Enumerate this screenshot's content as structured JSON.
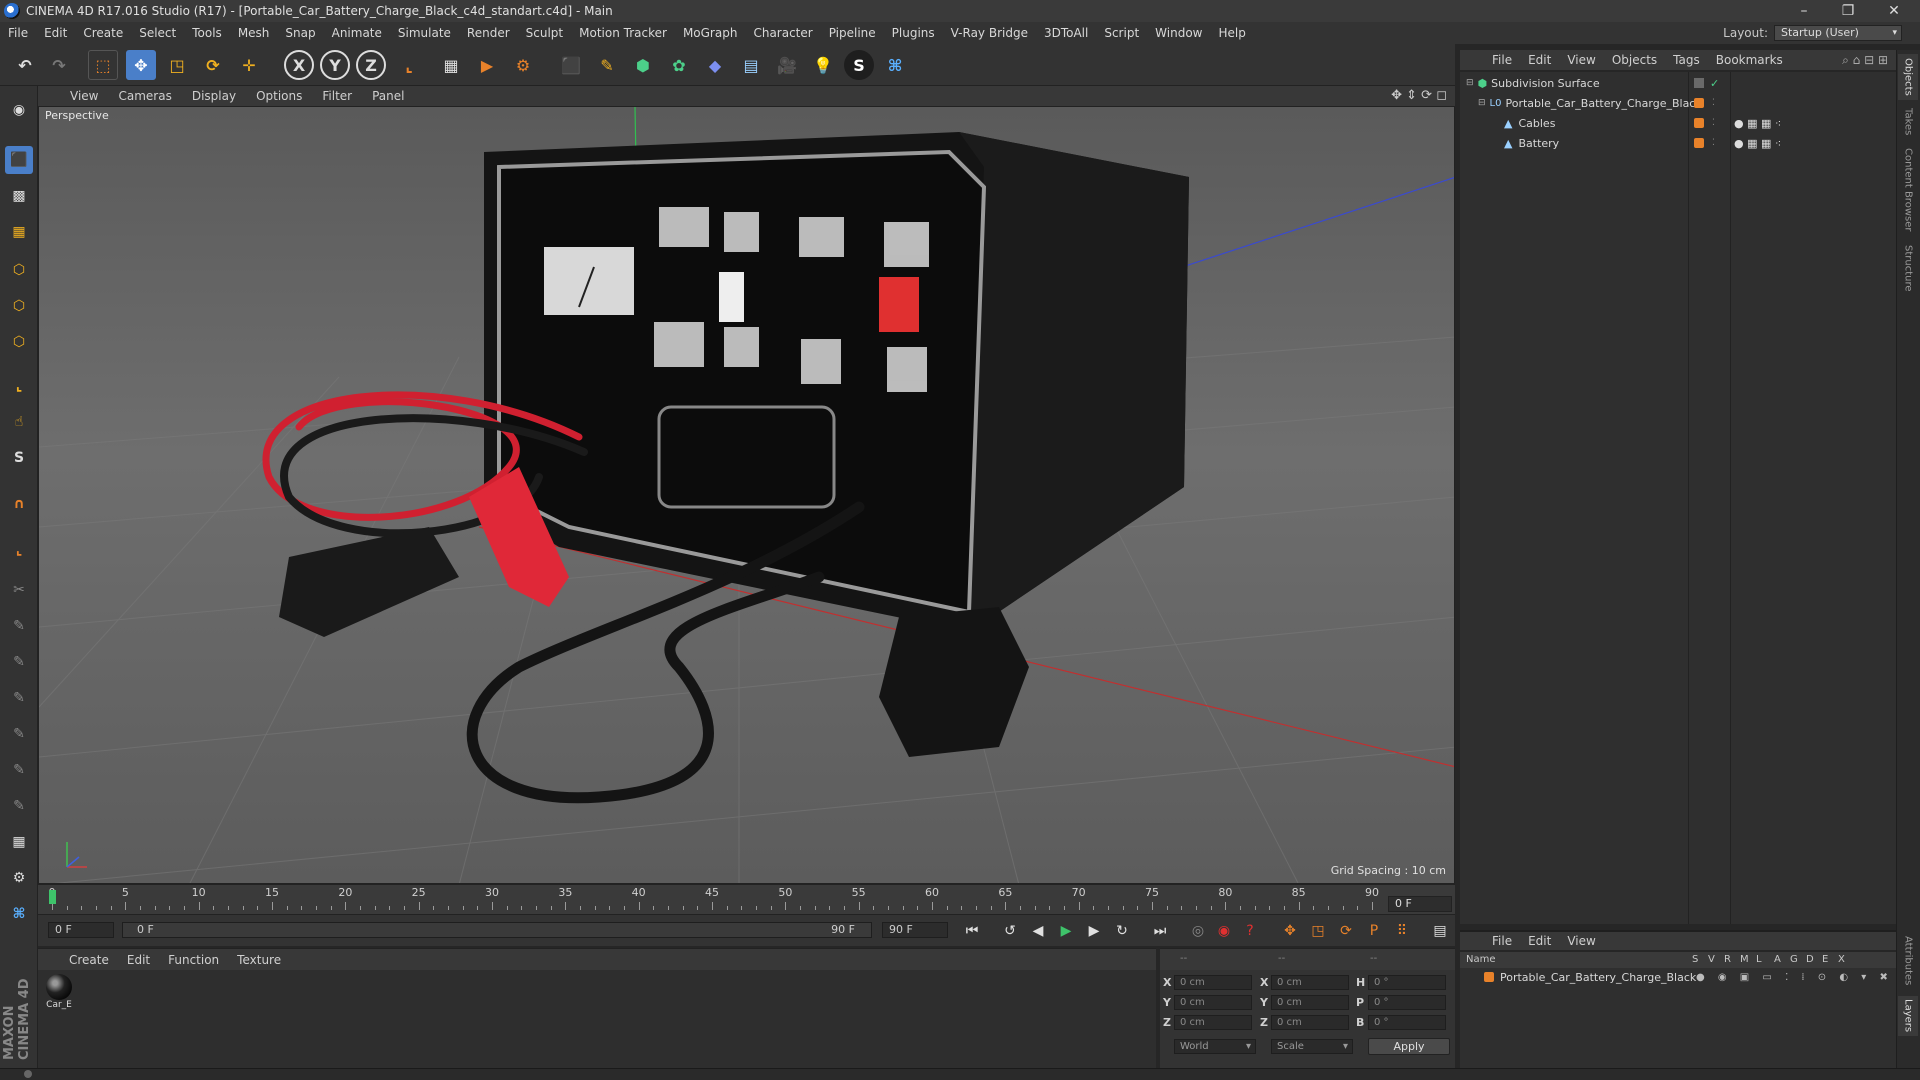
{
  "window": {
    "title": "CINEMA 4D R17.016 Studio (R17) - [Portable_Car_Battery_Charge_Black_c4d_standart.c4d] - Main"
  },
  "menubar": {
    "items": [
      "File",
      "Edit",
      "Create",
      "Select",
      "Tools",
      "Mesh",
      "Snap",
      "Animate",
      "Simulate",
      "Render",
      "Sculpt",
      "Motion Tracker",
      "MoGraph",
      "Character",
      "Pipeline",
      "Plugins",
      "V-Ray Bridge",
      "3DToAll",
      "Script",
      "Window",
      "Help"
    ],
    "layout_label": "Layout:",
    "layout_value": "Startup (User)"
  },
  "viewport": {
    "menu": [
      "View",
      "Cameras",
      "Display",
      "Options",
      "Filter",
      "Panel"
    ],
    "camera_label": "Perspective",
    "grid_spacing": "Grid Spacing : 10 cm"
  },
  "timeline": {
    "ticks": [
      "0",
      "5",
      "10",
      "15",
      "20",
      "25",
      "30",
      "35",
      "40",
      "45",
      "50",
      "55",
      "60",
      "65",
      "70",
      "75",
      "80",
      "85",
      "90"
    ],
    "current_frame_right": "0 F",
    "start_field": "0 F",
    "range_start": "0 F",
    "range_end": "90 F",
    "end_field": "90 F"
  },
  "material_manager": {
    "menu": [
      "Create",
      "Edit",
      "Function",
      "Texture"
    ],
    "materials": [
      {
        "name": "Car_E"
      }
    ]
  },
  "coordinates": {
    "header": [
      "--",
      "--",
      "--"
    ],
    "rows": [
      {
        "axis": "X",
        "pos": "0 cm",
        "size_axis": "X",
        "size": "0 cm",
        "rot_axis": "H",
        "rot": "0 °"
      },
      {
        "axis": "Y",
        "pos": "0 cm",
        "size_axis": "Y",
        "size": "0 cm",
        "rot_axis": "P",
        "rot": "0 °"
      },
      {
        "axis": "Z",
        "pos": "0 cm",
        "size_axis": "Z",
        "size": "0 cm",
        "rot_axis": "B",
        "rot": "0 °"
      }
    ],
    "mode": "World",
    "transform": "Scale",
    "apply_label": "Apply"
  },
  "object_manager": {
    "menu": [
      "File",
      "Edit",
      "View",
      "Objects",
      "Tags",
      "Bookmarks"
    ],
    "objects": [
      {
        "name": "Subdivision Surface"
      },
      {
        "name": "Portable_Car_Battery_Charge_Black"
      },
      {
        "name": "Cables"
      },
      {
        "name": "Battery"
      }
    ]
  },
  "attribute_manager": {
    "menu": [
      "File",
      "Edit",
      "View"
    ],
    "columns": [
      "Name",
      "S",
      "V",
      "R",
      "M",
      "L",
      "A",
      "G",
      "D",
      "E",
      "X"
    ],
    "rows": [
      {
        "name": "Portable_Car_Battery_Charge_Black"
      }
    ]
  },
  "right_tabs": [
    "Objects",
    "Takes",
    "Content Browser",
    "Structure",
    "Attributes",
    "Layers"
  ],
  "branding": {
    "logo_text": "MAXON CINEMA 4D"
  },
  "colors": {
    "accent_orange": "#e8822a",
    "active_blue": "#4a7fc9",
    "timeline_marker": "#3ec36a"
  }
}
